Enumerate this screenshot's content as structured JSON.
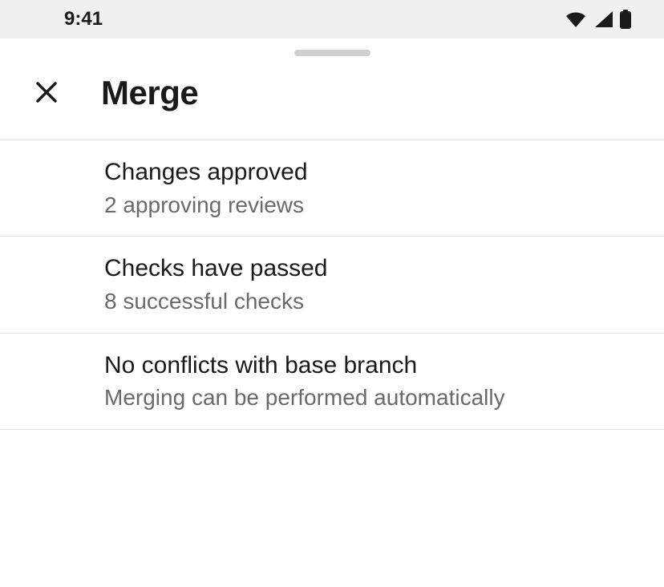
{
  "status": {
    "time": "9:41"
  },
  "header": {
    "title": "Merge"
  },
  "items": [
    {
      "title": "Changes approved",
      "subtitle": "2 approving reviews"
    },
    {
      "title": "Checks have passed",
      "subtitle": "8 successful checks"
    },
    {
      "title": "No conflicts with base branch",
      "subtitle": "Merging can be performed automatically"
    }
  ]
}
